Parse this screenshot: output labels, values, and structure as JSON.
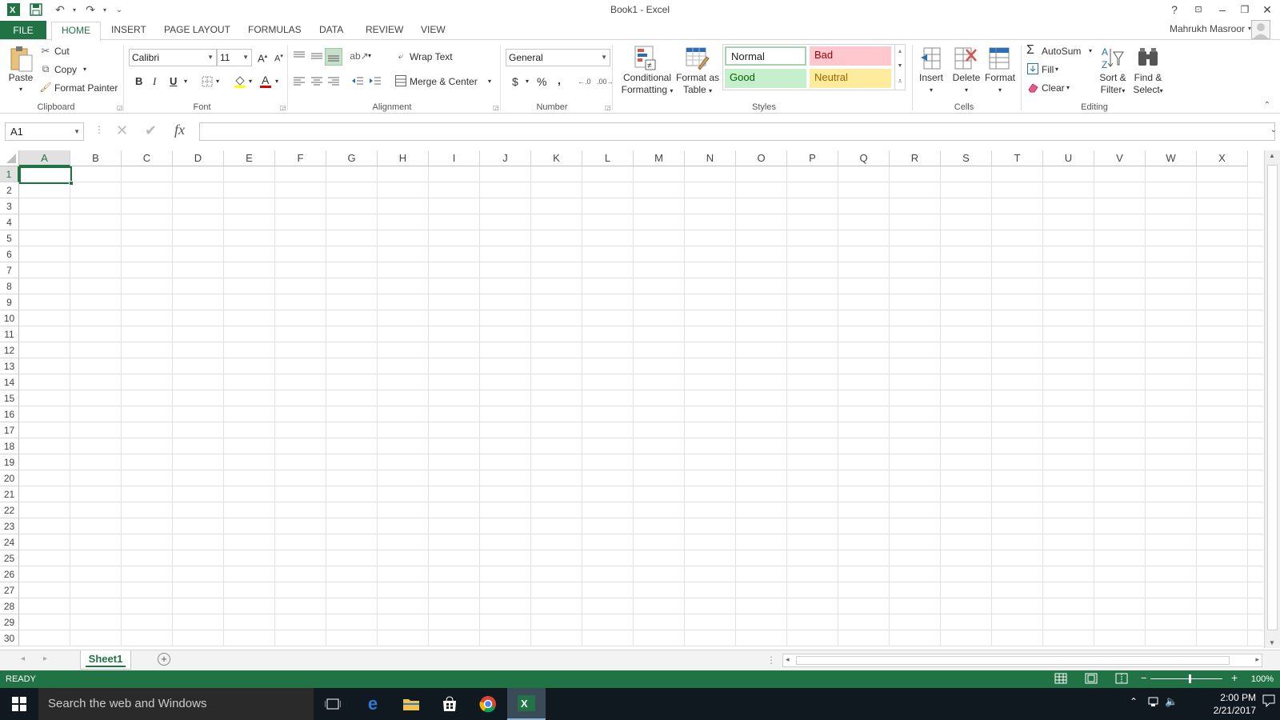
{
  "window": {
    "title": "Book1 - Excel",
    "user": "Mahrukh Masroor",
    "help": "?",
    "minimize": "–",
    "restore": "❐",
    "close": "✕"
  },
  "tabs": {
    "file": "FILE",
    "items": [
      "HOME",
      "INSERT",
      "PAGE LAYOUT",
      "FORMULAS",
      "DATA",
      "REVIEW",
      "VIEW"
    ],
    "active": "HOME"
  },
  "ribbon": {
    "clipboard": {
      "label": "Clipboard",
      "paste": "Paste",
      "cut": "Cut",
      "copy": "Copy",
      "format_painter": "Format Painter"
    },
    "font": {
      "label": "Font",
      "name": "Calibri",
      "size": "11",
      "bold": "B",
      "italic": "I",
      "underline": "U"
    },
    "alignment": {
      "label": "Alignment",
      "wrap_text": "Wrap Text",
      "merge_center": "Merge & Center"
    },
    "number": {
      "label": "Number",
      "format": "General",
      "currency": "$",
      "percent": "%",
      "comma": ","
    },
    "styles": {
      "label": "Styles",
      "conditional_formatting": [
        "Conditional",
        "Formatting"
      ],
      "format_as_table": [
        "Format as",
        "Table"
      ],
      "normal": "Normal",
      "bad": "Bad",
      "good": "Good",
      "neutral": "Neutral",
      "colors": {
        "bad_bg": "#ffc7ce",
        "bad_fg": "#9c0006",
        "good_bg": "#c6efce",
        "good_fg": "#006100",
        "neutral_bg": "#ffeb9c",
        "neutral_fg": "#9c6500"
      }
    },
    "cells": {
      "label": "Cells",
      "insert": "Insert",
      "delete": "Delete",
      "format": "Format"
    },
    "editing": {
      "label": "Editing",
      "autosum": "AutoSum",
      "fill": "Fill",
      "clear": "Clear",
      "sort_filter": [
        "Sort &",
        "Filter"
      ],
      "find_select": [
        "Find &",
        "Select"
      ]
    }
  },
  "formula_bar": {
    "name_box": "A1",
    "fx": "fx",
    "value": ""
  },
  "grid": {
    "columns": [
      "A",
      "B",
      "C",
      "D",
      "E",
      "F",
      "G",
      "H",
      "I",
      "J",
      "K",
      "L",
      "M",
      "N",
      "O",
      "P",
      "Q",
      "R",
      "S",
      "T",
      "U",
      "V",
      "W",
      "X"
    ],
    "rows": [
      "1",
      "2",
      "3",
      "4",
      "5",
      "6",
      "7",
      "8",
      "9",
      "10",
      "11",
      "12",
      "13",
      "14",
      "15",
      "16",
      "17",
      "18",
      "19",
      "20",
      "21",
      "22",
      "23",
      "24",
      "25",
      "26",
      "27",
      "28",
      "29",
      "30"
    ],
    "active_cell": "A1"
  },
  "sheets": {
    "tabs": [
      "Sheet1"
    ],
    "active": "Sheet1"
  },
  "status": {
    "text": "READY",
    "zoom": "100%"
  },
  "taskbar": {
    "search_placeholder": "Search the web and Windows",
    "time": "2:00 PM",
    "date": "2/21/2017"
  },
  "colors": {
    "accent": "#217346",
    "taskbar": "#101820"
  }
}
